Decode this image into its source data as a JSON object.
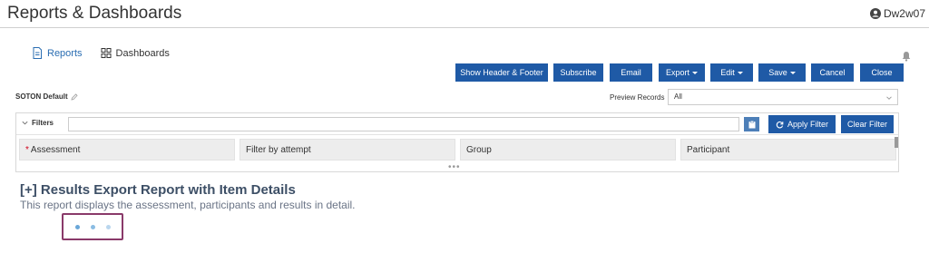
{
  "app": {
    "title": "Reports & Dashboards",
    "user": "Dw2w07"
  },
  "nav": {
    "tabs": [
      {
        "label": "Reports"
      },
      {
        "label": "Dashboards"
      }
    ]
  },
  "toolbar": {
    "show_header_footer": "Show Header & Footer",
    "subscribe": "Subscribe",
    "email": "Email",
    "export": "Export",
    "edit": "Edit",
    "save": "Save",
    "cancel": "Cancel",
    "close": "Close"
  },
  "report_settings": {
    "name": "SOTON Default",
    "preview_label": "Preview Records",
    "preview_value": "All"
  },
  "filters": {
    "label": "Filters",
    "search_value": "",
    "apply_label": "Apply Filter",
    "clear_label": "Clear Filter",
    "fields": [
      {
        "label": "Assessment",
        "required": "*"
      },
      {
        "label": "Filter by attempt"
      },
      {
        "label": "Group"
      },
      {
        "label": "Participant"
      }
    ]
  },
  "report": {
    "title": "[+] Results Export Report with Item Details",
    "description": "This report displays the assessment, participants and results in detail."
  },
  "colors": {
    "primary_button": "#1f5aa6",
    "accent_link": "#2a6db2",
    "loader_border": "#8a3a6a",
    "required": "#d0021b"
  }
}
